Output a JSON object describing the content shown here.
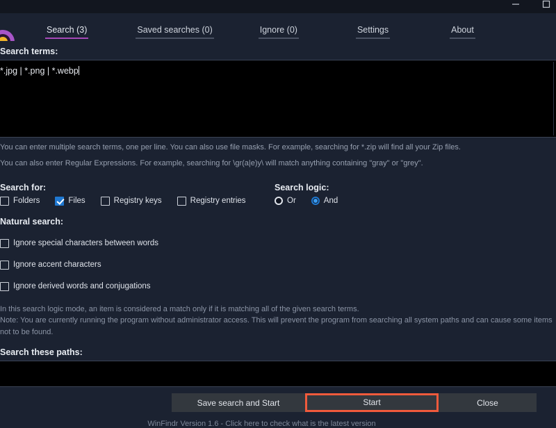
{
  "window": {
    "minimize_label": "minimize",
    "maximize_label": "maximize"
  },
  "tabs": [
    {
      "label": "Search (3)",
      "active": true
    },
    {
      "label": "Saved searches (0)",
      "active": false
    },
    {
      "label": "Ignore (0)",
      "active": false
    },
    {
      "label": "Settings",
      "active": false
    },
    {
      "label": "About",
      "active": false
    }
  ],
  "search_terms": {
    "label": "Search terms:",
    "value": "*.jpg | *.png | *.webp",
    "visible_value": "g | *.png | *.webp"
  },
  "hints": {
    "line1": "You can enter multiple search terms, one per line. You can also use file masks. For example, searching for *.zip will find all your Zip files.",
    "line2": "You can also enter Regular Expressions. For example, searching for \\gr(a|e)y\\ will match anything containing \"gray\" or \"grey\"."
  },
  "search_for": {
    "label": "Search for:",
    "options": [
      {
        "label": "Folders",
        "checked": false
      },
      {
        "label": "Files",
        "checked": true
      },
      {
        "label": "Registry keys",
        "checked": false
      },
      {
        "label": "Registry entries",
        "checked": false
      }
    ]
  },
  "search_logic": {
    "label": "Search logic:",
    "options": [
      {
        "label": "Or",
        "checked": false
      },
      {
        "label": "And",
        "checked": true
      }
    ]
  },
  "natural_search": {
    "label": "Natural search:",
    "options": [
      {
        "label": "Ignore special characters between words",
        "checked": false
      },
      {
        "label": "Ignore accent characters",
        "checked": false
      },
      {
        "label": "Ignore derived words and conjugations",
        "checked": false
      }
    ]
  },
  "notes": {
    "line1": "In this search logic mode, an item is considered a match only if it is matching all of the given search terms.",
    "line2": "Note: You are currently running the program without administrator access. This will prevent the program from searching all system paths and can cause some items not to be found."
  },
  "paths": {
    "label": "Search these paths:",
    "value": ""
  },
  "buttons": {
    "save_and_start": "Save search and Start",
    "start": "Start",
    "close": "Close"
  },
  "status": {
    "text": "WinFindr Version 1.6 - Click here to check what is the latest version"
  },
  "colors": {
    "background": "#1b2231",
    "titlebar": "#12161f",
    "input_background": "#000000",
    "accent_tab": "#a649b8",
    "accent_checkbox": "#1f78d1",
    "highlight_border": "#f05a3c",
    "logo_ring": "#a855c8",
    "logo_center": "#f0b429",
    "text_primary": "#e8ecf2",
    "text_muted": "#8c95a6"
  }
}
